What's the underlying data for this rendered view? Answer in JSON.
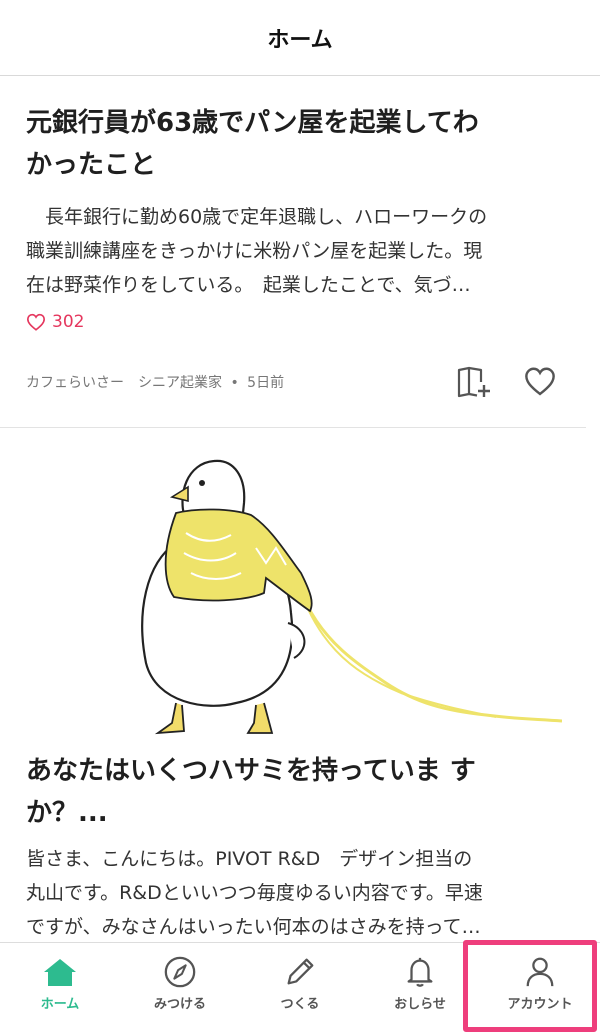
{
  "header": {
    "title": "ホーム"
  },
  "feed": {
    "articles": [
      {
        "title_line1": "元銀行員が63歳でパン屋を起業してわ",
        "title_line2": "かったこと",
        "excerpt_line1": "　長年銀行に勤め60歳で定年退職し、ハローワークの",
        "excerpt_line2": "職業訓練講座をきっかけに米粉パン屋を起業した。現",
        "excerpt_line3": "在は野菜作りをしている。　起業したことで、気づ…",
        "likes": "302",
        "author": "カフェらいさー　シニア起業家",
        "separator": "•",
        "date": "5日前"
      },
      {
        "title_line1": "あなたはいくつハサミを持っていますか？...",
        "title_line2": "か？...",
        "title_first": "あなたはいくつハサミを持っていま す",
        "excerpt_line1": "皆さま、こんにちは。PIVOT R&D　デザイン担当の",
        "excerpt_line2": "丸山です。R&Dといいつつ毎度ゆるい内容です。早速",
        "excerpt_line3": "ですが、みなさんはいったい何本のはさみを持って…"
      }
    ]
  },
  "tabbar": {
    "tabs": [
      {
        "label": "ホーム",
        "icon": "home-icon",
        "active": true
      },
      {
        "label": "みつける",
        "icon": "compass-icon",
        "active": false
      },
      {
        "label": "つくる",
        "icon": "pencil-icon",
        "active": false
      },
      {
        "label": "おしらせ",
        "icon": "bell-icon",
        "active": false
      },
      {
        "label": "アカウント",
        "icon": "person-icon",
        "active": false
      }
    ]
  },
  "colors": {
    "accent": "#2dbb8f",
    "like": "#e5375e",
    "highlight": "#ee3e7c",
    "illustration_yellow": "#eee36a"
  }
}
